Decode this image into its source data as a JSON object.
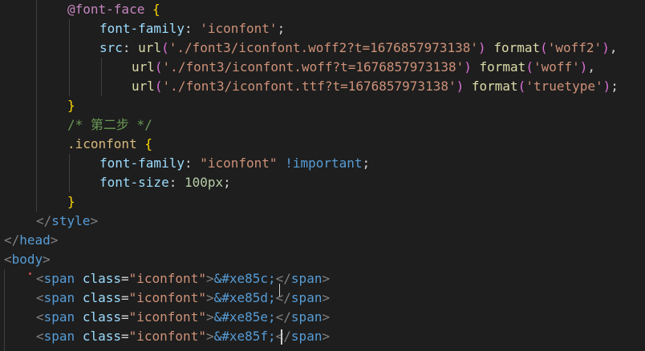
{
  "editor": {
    "lines": [
      {
        "tokens": [
          [
            "tok-at",
            "@font-face"
          ],
          [
            "tok-punct",
            " "
          ],
          [
            "tok-brace",
            "{"
          ]
        ]
      },
      {
        "tokens": [
          [
            "tok-prop",
            "font-family"
          ],
          [
            "tok-punct",
            ": "
          ],
          [
            "tok-str",
            "'iconfont'"
          ],
          [
            "tok-punct",
            ";"
          ]
        ]
      },
      {
        "tokens": [
          [
            "tok-prop",
            "src"
          ],
          [
            "tok-punct",
            ": "
          ],
          [
            "tok-fn",
            "url"
          ],
          [
            "tok-paren",
            "("
          ],
          [
            "tok-str",
            "'./font3/iconfont.woff2?t=1676857973138'"
          ],
          [
            "tok-paren",
            ")"
          ],
          [
            "tok-punct",
            " "
          ],
          [
            "tok-fn",
            "format"
          ],
          [
            "tok-paren",
            "("
          ],
          [
            "tok-str",
            "'woff2'"
          ],
          [
            "tok-paren",
            ")"
          ],
          [
            "tok-punct",
            ","
          ]
        ]
      },
      {
        "tokens": [
          [
            "tok-fn",
            "url"
          ],
          [
            "tok-paren",
            "("
          ],
          [
            "tok-str",
            "'./font3/iconfont.woff?t=1676857973138'"
          ],
          [
            "tok-paren",
            ")"
          ],
          [
            "tok-punct",
            " "
          ],
          [
            "tok-fn",
            "format"
          ],
          [
            "tok-paren",
            "("
          ],
          [
            "tok-str",
            "'woff'"
          ],
          [
            "tok-paren",
            ")"
          ],
          [
            "tok-punct",
            ","
          ]
        ]
      },
      {
        "tokens": [
          [
            "tok-fn",
            "url"
          ],
          [
            "tok-paren",
            "("
          ],
          [
            "tok-str",
            "'./font3/iconfont.ttf?t=1676857973138'"
          ],
          [
            "tok-paren",
            ")"
          ],
          [
            "tok-punct",
            " "
          ],
          [
            "tok-fn",
            "format"
          ],
          [
            "tok-paren",
            "("
          ],
          [
            "tok-str",
            "'truetype'"
          ],
          [
            "tok-paren",
            ")"
          ],
          [
            "tok-punct",
            ";"
          ]
        ]
      },
      {
        "tokens": [
          [
            "tok-brace",
            "}"
          ]
        ]
      },
      {
        "tokens": [
          [
            "tok-comment",
            "/* 第二步 */"
          ]
        ]
      },
      {
        "tokens": [
          [
            "tok-class",
            ".iconfont"
          ],
          [
            "tok-punct",
            " "
          ],
          [
            "tok-brace",
            "{"
          ]
        ]
      },
      {
        "tokens": [
          [
            "tok-prop",
            "font-family"
          ],
          [
            "tok-punct",
            ": "
          ],
          [
            "tok-str",
            "\"iconfont\""
          ],
          [
            "tok-punct",
            " "
          ],
          [
            "tok-kw",
            "!important"
          ],
          [
            "tok-punct",
            ";"
          ]
        ]
      },
      {
        "tokens": [
          [
            "tok-prop",
            "font-size"
          ],
          [
            "tok-punct",
            ": "
          ],
          [
            "tok-num",
            "100px"
          ],
          [
            "tok-punct",
            ";"
          ]
        ]
      },
      {
        "tokens": [
          [
            "tok-brace",
            "}"
          ]
        ]
      },
      {
        "tokens": [
          [
            "tok-angle",
            "</"
          ],
          [
            "tok-tag",
            "style"
          ],
          [
            "tok-angle",
            ">"
          ]
        ]
      },
      {
        "tokens": [
          [
            "tok-angle",
            "</"
          ],
          [
            "tok-tag",
            "head"
          ],
          [
            "tok-angle",
            ">"
          ]
        ]
      },
      {
        "tokens": [
          [
            "tok-angle",
            "<"
          ],
          [
            "tok-tag",
            "body"
          ],
          [
            "tok-angle",
            ">"
          ]
        ]
      },
      {
        "tokens": [
          [
            "tok-angle",
            "<"
          ],
          [
            "tok-tag",
            "span"
          ],
          [
            "tok-punct",
            " "
          ],
          [
            "tok-attr",
            "class"
          ],
          [
            "tok-punct",
            "="
          ],
          [
            "tok-str",
            "\"iconfont\""
          ],
          [
            "tok-angle",
            ">"
          ],
          [
            "tok-entity",
            "&#xe85c;"
          ],
          [
            "tok-angle",
            "</"
          ],
          [
            "tok-tag",
            "span"
          ],
          [
            "tok-angle",
            ">"
          ]
        ]
      },
      {
        "tokens": [
          [
            "tok-angle",
            "<"
          ],
          [
            "tok-tag",
            "span"
          ],
          [
            "tok-punct",
            " "
          ],
          [
            "tok-attr",
            "class"
          ],
          [
            "tok-punct",
            "="
          ],
          [
            "tok-str",
            "\"iconfont\""
          ],
          [
            "tok-angle",
            ">"
          ],
          [
            "tok-entity",
            "&#xe85d;"
          ],
          [
            "tok-angle",
            "</"
          ],
          [
            "tok-tag",
            "span"
          ],
          [
            "tok-angle",
            ">"
          ]
        ]
      },
      {
        "tokens": [
          [
            "tok-angle",
            "<"
          ],
          [
            "tok-tag",
            "span"
          ],
          [
            "tok-punct",
            " "
          ],
          [
            "tok-attr",
            "class"
          ],
          [
            "tok-punct",
            "="
          ],
          [
            "tok-str",
            "\"iconfont\""
          ],
          [
            "tok-angle",
            ">"
          ],
          [
            "tok-entity",
            "&#xe85e;"
          ],
          [
            "tok-angle",
            "</"
          ],
          [
            "tok-tag",
            "span"
          ],
          [
            "tok-angle",
            ">"
          ]
        ]
      },
      {
        "tokens": [
          [
            "tok-angle",
            "<"
          ],
          [
            "tok-tag",
            "span"
          ],
          [
            "tok-punct",
            " "
          ],
          [
            "tok-attr",
            "class"
          ],
          [
            "tok-punct",
            "="
          ],
          [
            "tok-str",
            "\"iconfont\""
          ],
          [
            "tok-angle",
            ">"
          ],
          [
            "tok-entity",
            "&#xe85f;"
          ],
          [
            "tok-angle",
            "</"
          ],
          [
            "tok-tag",
            "span"
          ],
          [
            "tok-angle",
            ">"
          ]
        ]
      }
    ]
  }
}
